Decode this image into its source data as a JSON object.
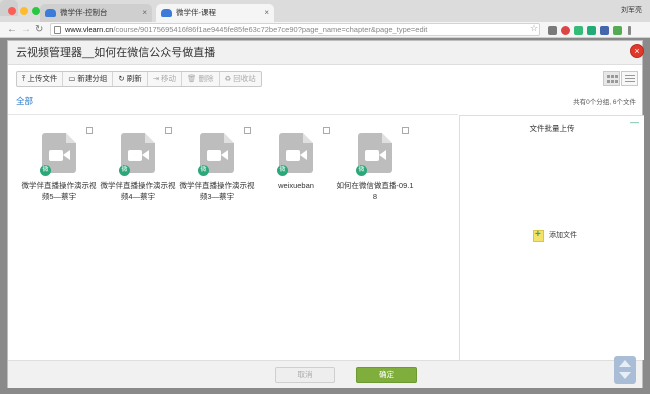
{
  "browser": {
    "tabs": [
      {
        "label": "微学伴-控制台"
      },
      {
        "label": "微学伴-课程"
      }
    ],
    "user": "刘军亮",
    "url_host": "www.vlearn.cn",
    "url_rest": "/course/90175695416f86f1ae9445fe85fe63c72be7ce90?page_name=chapter&page_type=edit"
  },
  "modal": {
    "title": "云视频管理器__如何在微信公众号做直播",
    "toolbar": {
      "upload": "上传文件",
      "new_group": "新建分组",
      "refresh": "刷新",
      "move": "移动",
      "delete": "删除",
      "recycle": "回收站"
    },
    "breadcrumb": "全部",
    "counts": "共有0个分组, 6个文件",
    "files": [
      {
        "name": "微学伴直播操作演示视频5—蔡宇",
        "badge": "微"
      },
      {
        "name": "微学伴直播操作演示视频4—蔡宇",
        "badge": "微"
      },
      {
        "name": "微学伴直播操作演示视频3—蔡宇",
        "badge": "微"
      },
      {
        "name": "weixueban",
        "badge": "微"
      },
      {
        "name": "如何在微信做直播-09.18",
        "badge": "微"
      }
    ],
    "upload_panel": {
      "title": "文件批量上传",
      "minimize": "—",
      "add_file": "添加文件"
    },
    "footer": {
      "cancel": "取消",
      "confirm": "确定"
    }
  },
  "colors": {
    "accent_green": "#7fae3d",
    "badge_green": "#2ca779",
    "link_blue": "#2a7acb",
    "close_red": "#e2382b"
  }
}
